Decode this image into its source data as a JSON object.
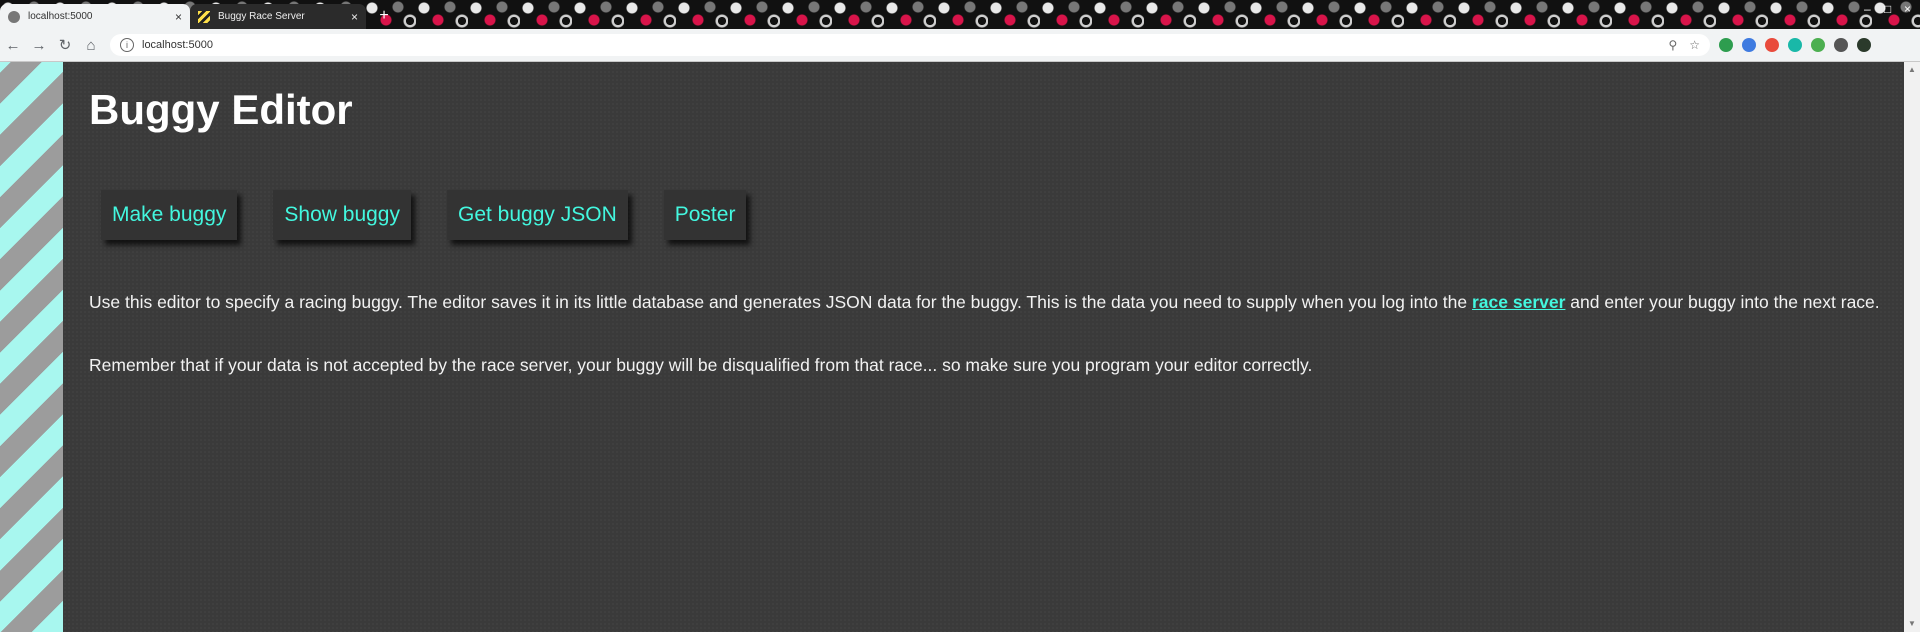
{
  "browser": {
    "tabs": [
      {
        "title": "localhost:5000",
        "active": true
      },
      {
        "title": "Buggy Race Server",
        "active": false
      }
    ],
    "new_tab": "+",
    "close_glyph": "×",
    "url": "localhost:5000",
    "accent": "#43f7df"
  },
  "page": {
    "heading": "Buggy Editor",
    "buttons": [
      {
        "label": "Make buggy"
      },
      {
        "label": "Show buggy"
      },
      {
        "label": "Get buggy JSON"
      },
      {
        "label": "Poster"
      }
    ],
    "intro_before": "Use this editor to specify a racing buggy. The editor saves it in its little database and generates JSON data for the buggy. This is the data you need to supply when you log into the ",
    "intro_link": "race server",
    "intro_after": " and enter your buggy into the next race.",
    "warning": "Remember that if your data is not accepted by the race server, your buggy will be disqualified from that race... so make sure you program your editor correctly."
  }
}
